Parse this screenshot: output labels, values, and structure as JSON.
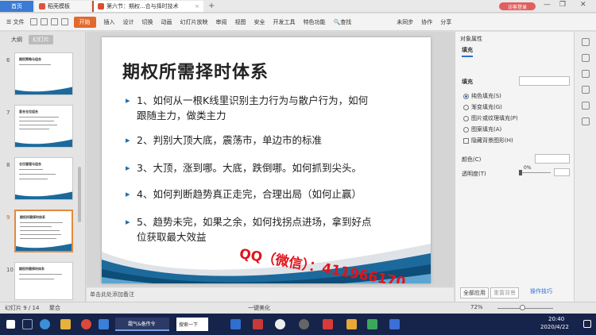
{
  "tabs": {
    "home": "首页",
    "template": "稻壳模板",
    "doc": "第六节：期权...合与择时技术",
    "new_tab": "+"
  },
  "login": {
    "label": "访客登录"
  },
  "menu": {
    "file": "文件",
    "start": "开始",
    "items": [
      "插入",
      "设计",
      "切换",
      "动画",
      "幻灯片放映",
      "审阅",
      "视图",
      "安全",
      "开发工具",
      "特色功能"
    ],
    "search": "查找",
    "sync": "未同步",
    "collab": "协作",
    "share": "分享"
  },
  "left_panel": {
    "tab_outline": "大纲",
    "tab_slides": "幻灯片",
    "thumbs": [
      {
        "num": "6",
        "title": "期权策略与组合"
      },
      {
        "num": "7",
        "title": "复合仓位组合"
      },
      {
        "num": "8",
        "title": "仓位管理与组合"
      },
      {
        "num": "9",
        "title": "期权所需择时体系"
      },
      {
        "num": "10",
        "title": "期权所需择时体系"
      }
    ]
  },
  "slide": {
    "title": "期权所需择时体系",
    "bullets": [
      {
        "line1": "1、如何从一根K线里识别主力行为与散户行为，如何",
        "line2": "跟随主力，做类主力"
      },
      {
        "line1": "2、判别大顶大底，震荡市，单边市的标准",
        "line2": ""
      },
      {
        "line1": "3、大顶，涨到哪。大底，跌倒哪。如何抓到尖头。",
        "line2": ""
      },
      {
        "line1": "4、如何判断趋势真正走完，合理出局（如何止赢）",
        "line2": ""
      },
      {
        "line1": "5、趋势未完，如果之余，如何找拐点进场，拿到好点",
        "line2": "位获取最大效益"
      }
    ],
    "watermark": "QQ（微信）：411966170"
  },
  "notes": {
    "placeholder": "单击此处添加备注"
  },
  "right_panel": {
    "header": "对象属性",
    "tab_fill": "填充",
    "section": "填充",
    "options": [
      "纯色填充(S)",
      "渐变填充(G)",
      "图片或纹理填充(P)",
      "图案填充(A)"
    ],
    "selected_option": 0,
    "hide_bg": "隐藏背景图形(H)",
    "color_label": "颜色(C)",
    "transparency_label": "透明度(T)",
    "transparency_value": "0%",
    "apply_all": "全部应用",
    "reset_bg": "重置背景",
    "tips": "操作技巧"
  },
  "status": {
    "slide_info": "幻灯片 9 / 14",
    "theme": "聚合",
    "beautify": "一键美化",
    "zoom": "72%"
  },
  "taskbar": {
    "app_label": "霜气&备传令",
    "search": "搜索一下",
    "time": "20:40",
    "date": "2020/4/22"
  },
  "colors": {
    "accent": "#e26a2c",
    "bullet": "#1e6fa8",
    "watermark": "#e0141a",
    "wave": "#1c6a9c"
  }
}
